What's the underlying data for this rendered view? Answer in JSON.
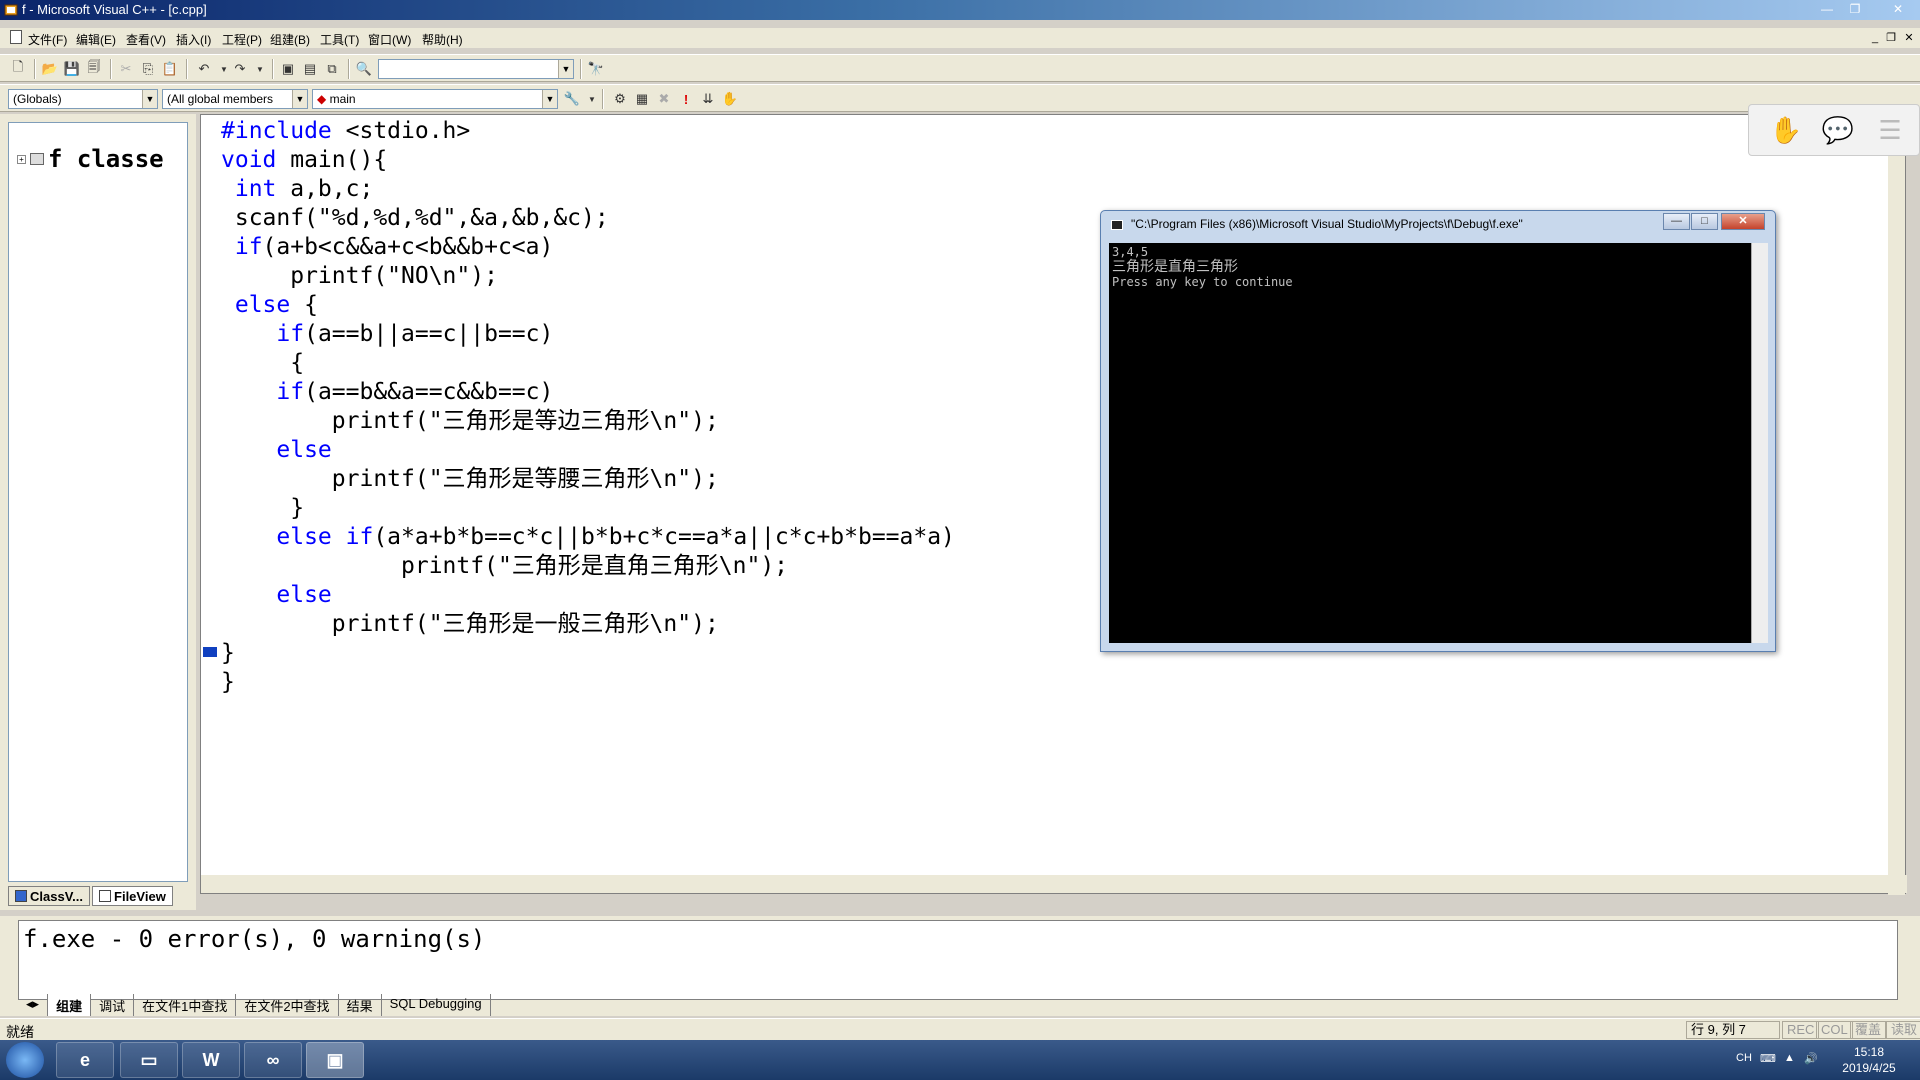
{
  "window": {
    "title": "f - Microsoft Visual C++ - [c.cpp]"
  },
  "menu": {
    "items": [
      "文件(F)",
      "编辑(E)",
      "查看(V)",
      "插入(I)",
      "工程(P)",
      "组建(B)",
      "工具(T)",
      "窗口(W)",
      "帮助(H)"
    ]
  },
  "toolbar": {
    "combo_empty": "",
    "globals_combo": "(Globals)",
    "members_combo": "(All global members",
    "function_combo": "main"
  },
  "workspace": {
    "tree_root": "f classe",
    "tabs": [
      "ClassV...",
      "FileView"
    ]
  },
  "editor": {
    "lines": [
      [
        "#include",
        " <stdio.h>"
      ],
      [
        "void",
        " main(){"
      ],
      [
        " int",
        " a,b,c;"
      ],
      [
        "",
        " scanf(\"%d,%d,%d\",&a,&b,&c);"
      ],
      [
        " if",
        "(a+b<c&&a+c<b&&b+c<a)"
      ],
      [
        "",
        "     printf(\"NO\\n\");"
      ],
      [
        " else",
        " {"
      ],
      [
        "    if",
        "(a==b||a==c||b==c)"
      ],
      [
        "",
        "     {"
      ],
      [
        "    if",
        "(a==b&&a==c&&b==c)"
      ],
      [
        "",
        "        printf(\"三角形是等边三角形\\n\");"
      ],
      [
        "    else",
        ""
      ],
      [
        "",
        "        printf(\"三角形是等腰三角形\\n\");"
      ],
      [
        "",
        "     }"
      ],
      [
        "    else if",
        "(a*a+b*b==c*c||b*b+c*c==a*a||c*c+b*b==a*a)"
      ],
      [
        "",
        "             printf(\"三角形是直角三角形\\n\");"
      ],
      [
        "    else",
        ""
      ],
      [
        "",
        "        printf(\"三角形是一般三角形\\n\");"
      ],
      [
        "",
        "}"
      ],
      [
        "",
        "}"
      ]
    ]
  },
  "console": {
    "title": "\"C:\\Program Files (x86)\\Microsoft Visual Studio\\MyProjects\\f\\Debug\\f.exe\"",
    "lines": [
      "3,4,5",
      "三角形是直角三角形",
      "Press any key to continue"
    ]
  },
  "output": {
    "text": "f.exe - 0 error(s), 0 warning(s)",
    "tabs": [
      "组建",
      "调试",
      "在文件1中查找",
      "在文件2中查找",
      "结果",
      "SQL Debugging"
    ]
  },
  "status": {
    "text": "就绪",
    "position": "行 9, 列 7",
    "indicators": [
      "REC",
      "COL",
      "覆盖",
      "读取"
    ]
  },
  "taskbar": {
    "time": "15:18",
    "date": "2019/4/25",
    "lang": "CH"
  }
}
